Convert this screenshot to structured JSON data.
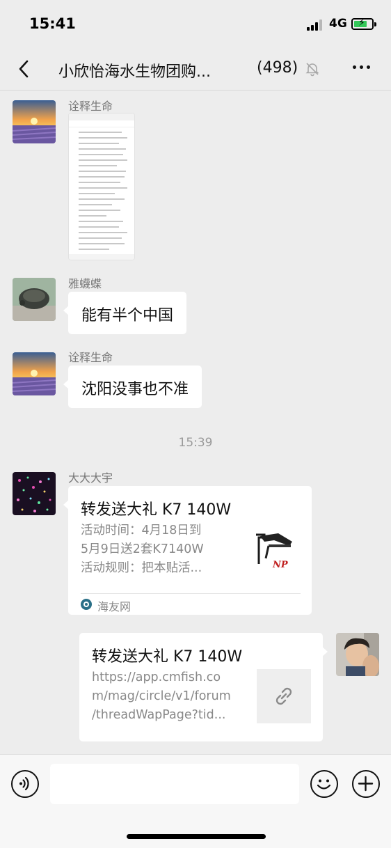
{
  "status_bar": {
    "time": "15:41",
    "network": "4G",
    "battery_color": "#34c759"
  },
  "nav": {
    "title": "小欣怡海水生物团购...",
    "member_count": "(498)",
    "icons": [
      "back-icon",
      "mute-bell-icon",
      "more-icon"
    ]
  },
  "messages": [
    {
      "sender": "诠释生命",
      "type": "image",
      "avatar": "sunset-lavender"
    },
    {
      "sender": "雅蠛蝶",
      "type": "text",
      "text": "能有半个中国",
      "avatar": "turtle"
    },
    {
      "sender": "诠释生命",
      "type": "text",
      "text": "沈阳没事也不准",
      "avatar": "sunset-lavender"
    }
  ],
  "timestamp": "15:39",
  "link_card_1": {
    "sender": "大大大宇",
    "title": "转发送大礼 K7 140W",
    "desc_lines": [
      "活动时间：4月18日到",
      "5月9日送2套K7140W",
      "活动规则：把本贴活..."
    ],
    "source": "海友网",
    "thumb_logo": "NP"
  },
  "link_card_2": {
    "title": "转发送大礼 K7 140W",
    "desc_lines": [
      "https://app.cmfish.co",
      "m/mag/circle/v1/forum",
      "/threadWapPage?tid..."
    ],
    "thumb_icon": "link-icon"
  },
  "input_bar": {
    "placeholder": "",
    "icons": [
      "voice-icon",
      "emoji-icon",
      "plus-icon"
    ]
  }
}
